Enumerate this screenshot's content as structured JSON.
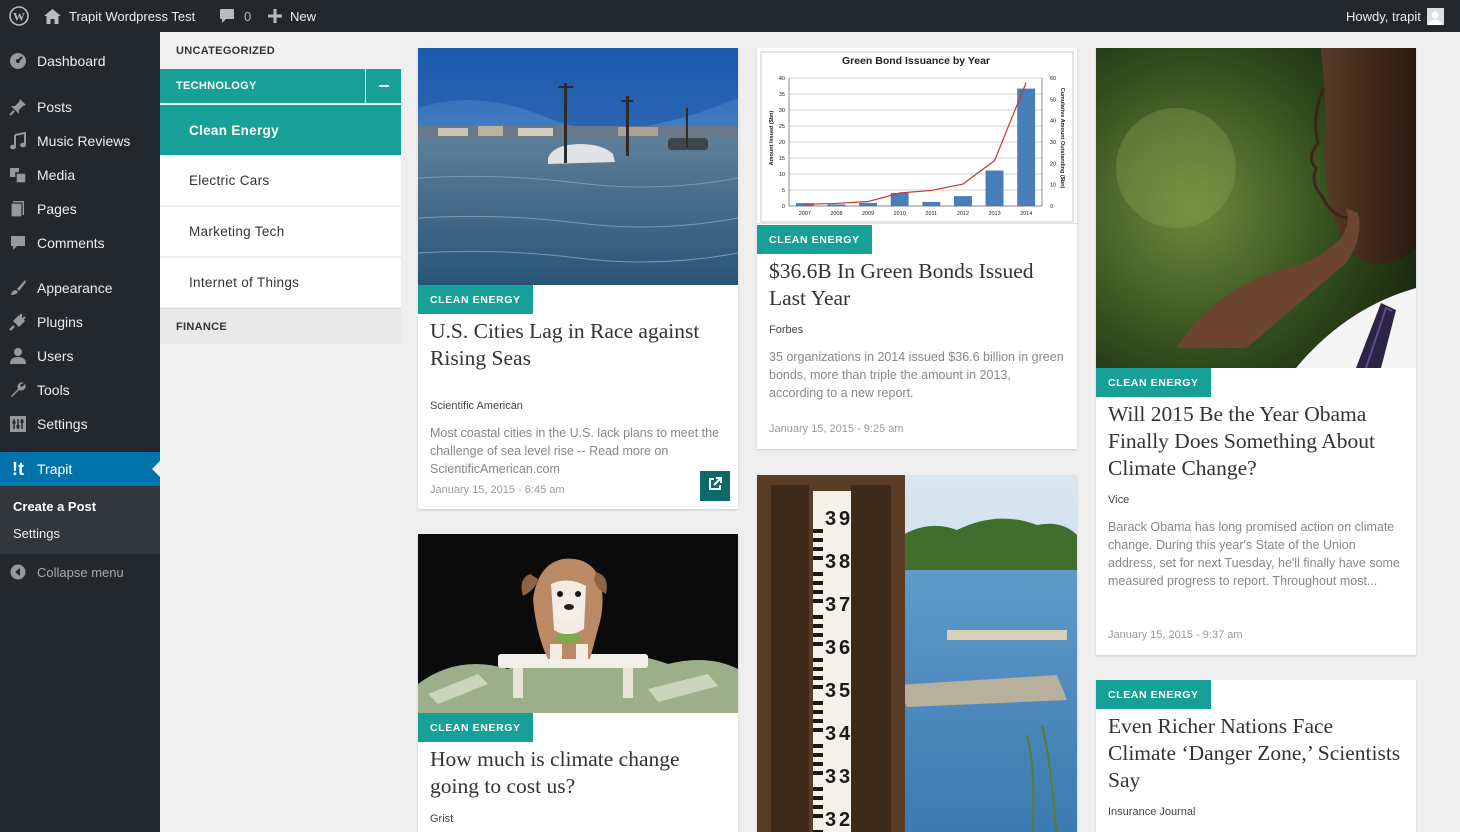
{
  "adminbar": {
    "site_name": "Trapit Wordpress Test",
    "comments_count": "0",
    "new_label": "New",
    "greeting": "Howdy, trapit"
  },
  "menu": {
    "dashboard": "Dashboard",
    "posts": "Posts",
    "music_reviews": "Music Reviews",
    "media": "Media",
    "pages": "Pages",
    "comments": "Comments",
    "appearance": "Appearance",
    "plugins": "Plugins",
    "users": "Users",
    "tools": "Tools",
    "settings": "Settings",
    "trapit": "Trapit",
    "sub_create": "Create a Post",
    "sub_settings": "Settings",
    "collapse": "Collapse menu"
  },
  "categories": {
    "uncategorized": "UNCATEGORIZED",
    "technology": "TECHNOLOGY",
    "subs": [
      "Clean Energy",
      "Electric Cars",
      "Marketing Tech",
      "Internet of Things"
    ],
    "finance": "FINANCE"
  },
  "colors": {
    "accent": "#17a097",
    "admin_dark": "#23282d",
    "admin_blue": "#0073aa"
  },
  "cards": [
    {
      "tag": "CLEAN ENERGY",
      "title": "U.S. Cities Lag in Race against Rising Seas",
      "source": "Scientific American",
      "excerpt": "Most coastal cities in the U.S. lack plans to meet the challenge of sea level rise -- Read more on ScientificAmerican.com",
      "date": "January 15, 2015 - 6:45 am"
    },
    {
      "tag": "CLEAN ENERGY",
      "title": "$36.6B In Green Bonds Issued Last Year",
      "source": "Forbes",
      "excerpt": "35 organizations in 2014 issued $36.6 billion in green bonds, more than triple the amount in 2013, according to a new report.",
      "date": "January 15, 2015 - 9:25 am"
    },
    {
      "tag": "CLEAN ENERGY",
      "title": "Will 2015 Be the Year Obama Finally Does Something About Climate Change?",
      "source": "Vice",
      "excerpt": "Barack Obama has long promised action on climate change. During this year's State of the Union address, set for next Tuesday, he'll finally have some measured progress to report. Throughout most...",
      "date": "January 15, 2015 - 9:37 am"
    },
    {
      "tag": "CLEAN ENERGY",
      "title": "How much is climate change going to cost us?",
      "source": "Grist"
    },
    {
      "tag": "CLEAN ENERGY",
      "title": "Even Richer Nations Face Climate ‘Danger Zone,’ Scientists Say",
      "source": "Insurance Journal"
    }
  ],
  "chart_data": {
    "type": "bar",
    "title": "Green Bond Issuance by Year",
    "categories": [
      "2007",
      "2008",
      "2009",
      "2010",
      "2011",
      "2012",
      "2013",
      "2014"
    ],
    "series": [
      {
        "values": [
          0.8,
          0.4,
          0.9,
          4,
          1.2,
          3,
          11,
          36.6
        ]
      },
      {
        "values": [
          0.8,
          1.2,
          2.1,
          6.1,
          7.3,
          10.3,
          21.3,
          57.9
        ]
      }
    ],
    "ylabel": "Amount Issued ($bn)",
    "y2label": "Cumulative Amount Outstanding ($bn)",
    "ylim": [
      0,
      40
    ],
    "y2lim": [
      0,
      60
    ],
    "yticks": [
      "0",
      "5",
      "10",
      "15",
      "20",
      "25",
      "30",
      "35",
      "40"
    ],
    "y2ticks": [
      "0",
      "10",
      "20",
      "30",
      "40",
      "50",
      "60"
    ],
    "grid": true
  },
  "gauge_numbers": [
    "3",
    "9",
    "3",
    "8",
    "3",
    "7",
    "3",
    "6",
    "3",
    "5",
    "3",
    "4",
    "3",
    "3",
    "3",
    "2"
  ]
}
